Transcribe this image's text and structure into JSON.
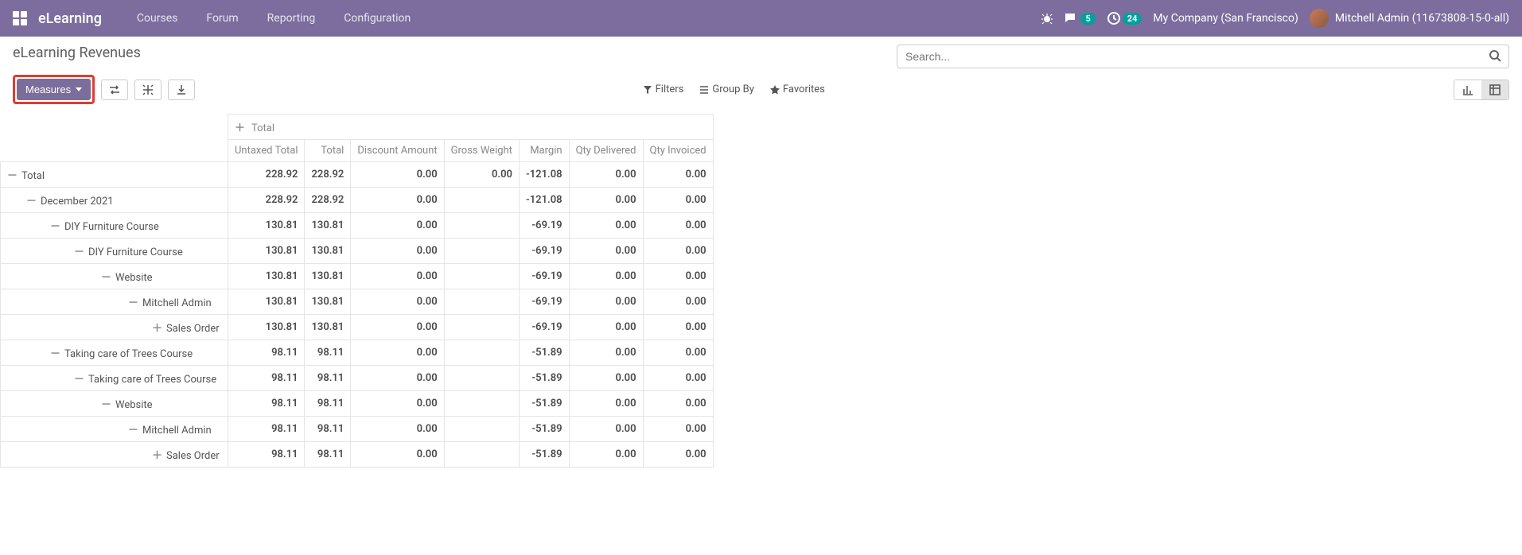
{
  "nav": {
    "app_title": "eLearning",
    "links": [
      "Courses",
      "Forum",
      "Reporting",
      "Configuration"
    ],
    "msg_badge": "5",
    "activity_badge": "24",
    "company": "My Company (San Francisco)",
    "user": "Mitchell Admin (11673808-15-0-all)"
  },
  "page": {
    "title": "eLearning Revenues",
    "measures_label": "Measures",
    "search_placeholder": "Search...",
    "filters": {
      "filters": "Filters",
      "groupby": "Group By",
      "favorites": "Favorites"
    }
  },
  "pivot": {
    "col_header_label": "Total",
    "columns": [
      "Untaxed Total",
      "Total",
      "Discount Amount",
      "Gross Weight",
      "Margin",
      "Qty Delivered",
      "Qty Invoiced"
    ],
    "rows": [
      {
        "label": "Total",
        "indent": 0,
        "toggle": "minus",
        "values": [
          "228.92",
          "228.92",
          "0.00",
          "0.00",
          "-121.08",
          "0.00",
          "0.00"
        ]
      },
      {
        "label": "December 2021",
        "indent": 1,
        "toggle": "minus",
        "values": [
          "228.92",
          "228.92",
          "0.00",
          "",
          "-121.08",
          "0.00",
          "0.00"
        ]
      },
      {
        "label": "DIY Furniture Course",
        "indent": 2,
        "toggle": "minus",
        "values": [
          "130.81",
          "130.81",
          "0.00",
          "",
          "-69.19",
          "0.00",
          "0.00"
        ]
      },
      {
        "label": "DIY Furniture Course",
        "indent": 3,
        "toggle": "minus",
        "values": [
          "130.81",
          "130.81",
          "0.00",
          "",
          "-69.19",
          "0.00",
          "0.00"
        ]
      },
      {
        "label": "Website",
        "indent": 4,
        "toggle": "minus",
        "values": [
          "130.81",
          "130.81",
          "0.00",
          "",
          "-69.19",
          "0.00",
          "0.00"
        ]
      },
      {
        "label": "Mitchell Admin",
        "indent": 5,
        "toggle": "minus",
        "values": [
          "130.81",
          "130.81",
          "0.00",
          "",
          "-69.19",
          "0.00",
          "0.00"
        ]
      },
      {
        "label": "Sales Order",
        "indent": 6,
        "toggle": "plus",
        "values": [
          "130.81",
          "130.81",
          "0.00",
          "",
          "-69.19",
          "0.00",
          "0.00"
        ]
      },
      {
        "label": "Taking care of Trees Course",
        "indent": 2,
        "toggle": "minus",
        "values": [
          "98.11",
          "98.11",
          "0.00",
          "",
          "-51.89",
          "0.00",
          "0.00"
        ]
      },
      {
        "label": "Taking care of Trees Course",
        "indent": 3,
        "toggle": "minus",
        "values": [
          "98.11",
          "98.11",
          "0.00",
          "",
          "-51.89",
          "0.00",
          "0.00"
        ]
      },
      {
        "label": "Website",
        "indent": 4,
        "toggle": "minus",
        "values": [
          "98.11",
          "98.11",
          "0.00",
          "",
          "-51.89",
          "0.00",
          "0.00"
        ]
      },
      {
        "label": "Mitchell Admin",
        "indent": 5,
        "toggle": "minus",
        "values": [
          "98.11",
          "98.11",
          "0.00",
          "",
          "-51.89",
          "0.00",
          "0.00"
        ]
      },
      {
        "label": "Sales Order",
        "indent": 6,
        "toggle": "plus",
        "values": [
          "98.11",
          "98.11",
          "0.00",
          "",
          "-51.89",
          "0.00",
          "0.00"
        ]
      }
    ]
  }
}
